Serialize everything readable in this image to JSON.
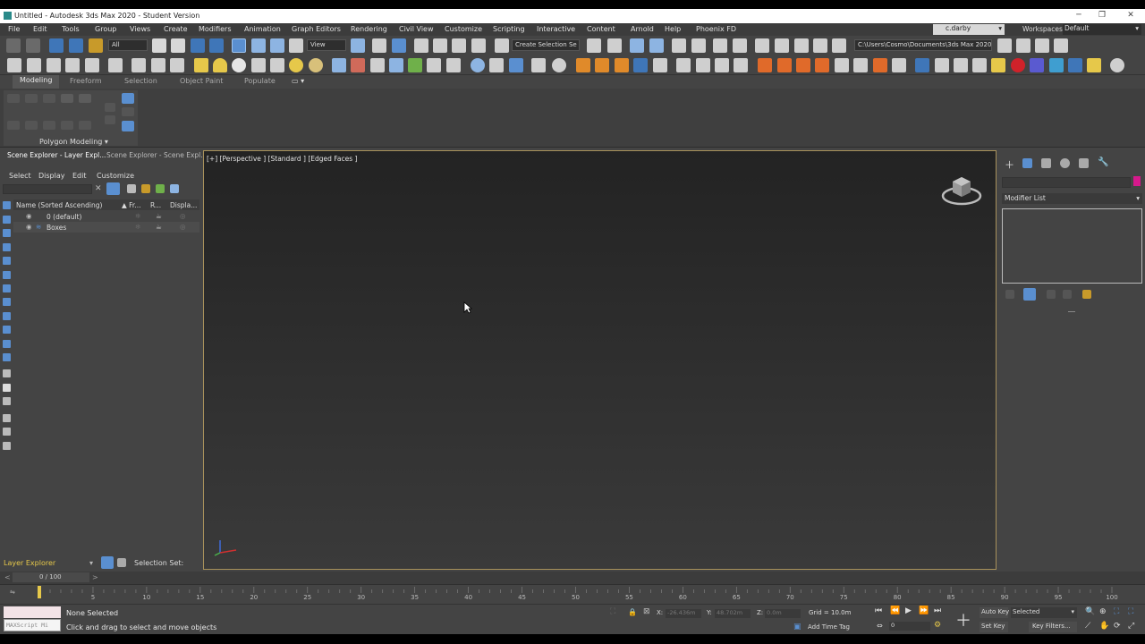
{
  "window": {
    "title": "Untitled - Autodesk 3ds Max 2020 - Student Version",
    "minimize": "─",
    "restore": "❐",
    "close": "✕"
  },
  "menu": [
    "File",
    "Edit",
    "Tools",
    "Group",
    "Views",
    "Create",
    "Modifiers",
    "Animation",
    "Graph Editors",
    "Rendering",
    "Civil View",
    "Customize",
    "Scripting",
    "Interactive",
    "Content",
    "Arnold",
    "Help",
    "Phoenix FD"
  ],
  "user": "c.darby",
  "workspace": {
    "label": "Workspaces:",
    "value": "Default"
  },
  "toolbar": {
    "selection_filter": "All",
    "ref_coord": "View",
    "named_selection": "Create Selection Se",
    "project_path": "C:\\Users\\Cosmo\\Documents\\3ds Max 2020"
  },
  "ribbon": {
    "tabs": [
      "Modeling",
      "Freeform",
      "Selection",
      "Object Paint",
      "Populate"
    ],
    "panel_label": "Polygon Modeling ▾"
  },
  "scene_explorer": {
    "tabs": [
      "Scene Explorer - Layer Expl...",
      "Scene Explorer - Scene Expl..."
    ],
    "menu": [
      "Select",
      "Display",
      "Edit",
      "Customize"
    ],
    "columns": {
      "name": "Name (Sorted Ascending)",
      "frozen": "▲ Fr...",
      "render": "R...",
      "display": "Displa..."
    },
    "rows": [
      {
        "name": "0 (default)"
      },
      {
        "name": "Boxes"
      }
    ],
    "bottom_label": "Layer Explorer",
    "selection_set_label": "Selection Set:"
  },
  "viewport": {
    "label": "[+] [Perspective ] [Standard ] [Edged Faces ]"
  },
  "command_panel": {
    "modifier_list": "Modifier List"
  },
  "timeline": {
    "frame_display": "0 / 100",
    "ticks": [
      "5",
      "10",
      "15",
      "20",
      "25",
      "30",
      "35",
      "40",
      "45",
      "50",
      "55",
      "60",
      "65",
      "70",
      "75",
      "80",
      "85",
      "90",
      "95",
      "100"
    ],
    "current_frame": 0,
    "total_frames": 100
  },
  "status": {
    "maxscript": "MAXScript Mi",
    "selection": "None Selected",
    "prompt": "Click and drag to select and move objects",
    "x_label": "X:",
    "x_value": "-26.436m",
    "y_label": "Y:",
    "y_value": "48.702m",
    "z_label": "Z:",
    "z_value": "0.0m",
    "grid": "Grid = 10.0m",
    "add_time_tag": "Add Time Tag",
    "auto_key": "Auto Key",
    "selected": "Selected",
    "set_key": "Set Key",
    "key_filters": "Key Filters...",
    "frame_field": "0"
  },
  "colors": {
    "accent_blue": "#5a8fd0",
    "viewport_border": "#a8915b",
    "swatch": "#d6198c"
  }
}
